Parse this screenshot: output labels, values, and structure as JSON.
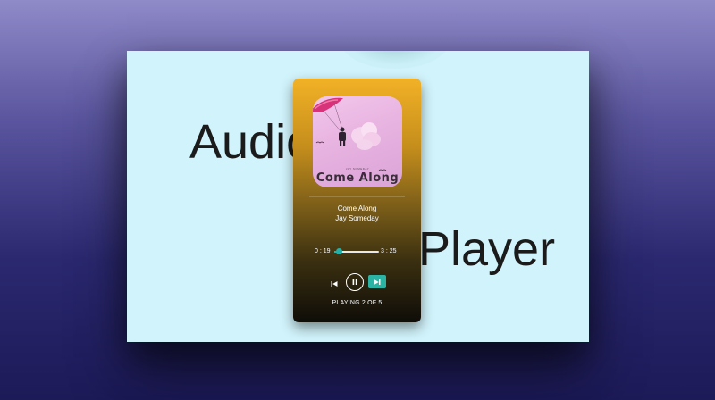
{
  "background": {
    "heading_left": "Audio",
    "heading_right": "Player"
  },
  "player": {
    "album_art": {
      "title": "Come Along",
      "small_text": "JAY SOMEDAY"
    },
    "track": {
      "title": "Come Along",
      "artist": "Jay Someday"
    },
    "time": {
      "current": "0 : 19",
      "duration": "3 : 25",
      "progress_fraction": 0.09
    },
    "controls": {
      "prev_icon": "skip-previous-icon",
      "pause_icon": "pause-icon",
      "next_icon": "skip-next-icon"
    },
    "status": "PLAYING 2 OF 5",
    "colors": {
      "accent": "#20b2aa",
      "top": "#f2b126",
      "bottom": "#0f0d08"
    }
  }
}
